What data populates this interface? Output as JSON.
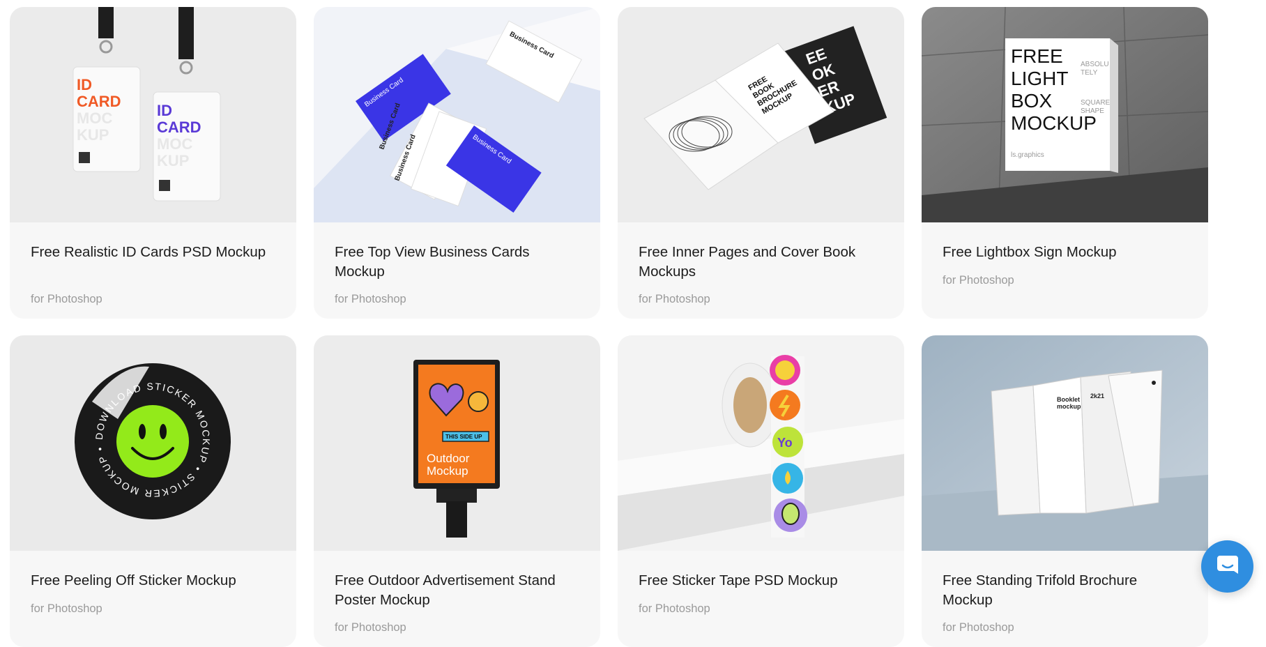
{
  "cards": [
    {
      "title": "Free Realistic ID Cards PSD Mockup",
      "subtitle": "for Photoshop",
      "thumb_icon": "id-card-lanyard-thumb",
      "art": {
        "id_card": "ID",
        "card_word": "CARD",
        "moc": "MOC",
        "kup": "KUP"
      }
    },
    {
      "title": "Free Top View Business Cards Mockup",
      "subtitle": "for Photoshop",
      "thumb_icon": "business-cards-thumb",
      "art": {
        "card_text": "Business Card"
      }
    },
    {
      "title": "Free Inner Pages and Cover Book Mockups",
      "subtitle": "for Photoshop",
      "thumb_icon": "open-book-thumb",
      "art": {
        "l1": "FREE",
        "l2": "BOOK",
        "l3": "BROCHURE",
        "l4": "MOCKUP",
        "c1": "EE",
        "c2": "OK",
        "c3": "ER",
        "c4": "KUP"
      }
    },
    {
      "title": "Free Lightbox Sign Mockup",
      "subtitle": "for Photoshop",
      "thumb_icon": "lightbox-sign-thumb",
      "art": {
        "l1": "FREE",
        "l2": "LIGHT",
        "l3": "BOX",
        "l4": "MOCKUP",
        "s1": "ABSOLU",
        "s2": "TELY",
        "s3": "SQUARE",
        "s4": "SHAPE",
        "brand": "ls.graphics"
      }
    },
    {
      "title": "Free Peeling Off Sticker Mockup",
      "subtitle": "for Photoshop",
      "thumb_icon": "peeling-sticker-thumb",
      "art": {
        "ring": "DOWNLOAD STICKER MOCKUP • STICKER MOCKUP •"
      }
    },
    {
      "title": "Free Outdoor Advertisement Stand Poster Mockup",
      "subtitle": "for Photoshop",
      "thumb_icon": "outdoor-stand-thumb",
      "art": {
        "tag": "THIS SIDE UP",
        "l1": "Outdoor",
        "l2": "Mockup"
      }
    },
    {
      "title": "Free Sticker Tape PSD Mockup",
      "subtitle": "for Photoshop",
      "thumb_icon": "sticker-tape-thumb",
      "art": {
        "yo": "Yo"
      }
    },
    {
      "title": "Free Standing Trifold Brochure Mockup",
      "subtitle": "for Photoshop",
      "thumb_icon": "trifold-brochure-thumb",
      "art": {
        "b1": "Booklet",
        "b2": "mockup",
        "year": "2k21"
      }
    }
  ],
  "chat": {
    "icon": "chat-icon"
  },
  "colors": {
    "card_bg": "#f7f7f7",
    "title": "#1c1c1c",
    "subtitle": "#9a9a9a",
    "chat": "#2f8ee0",
    "accent_blue": "#3a35e6"
  }
}
